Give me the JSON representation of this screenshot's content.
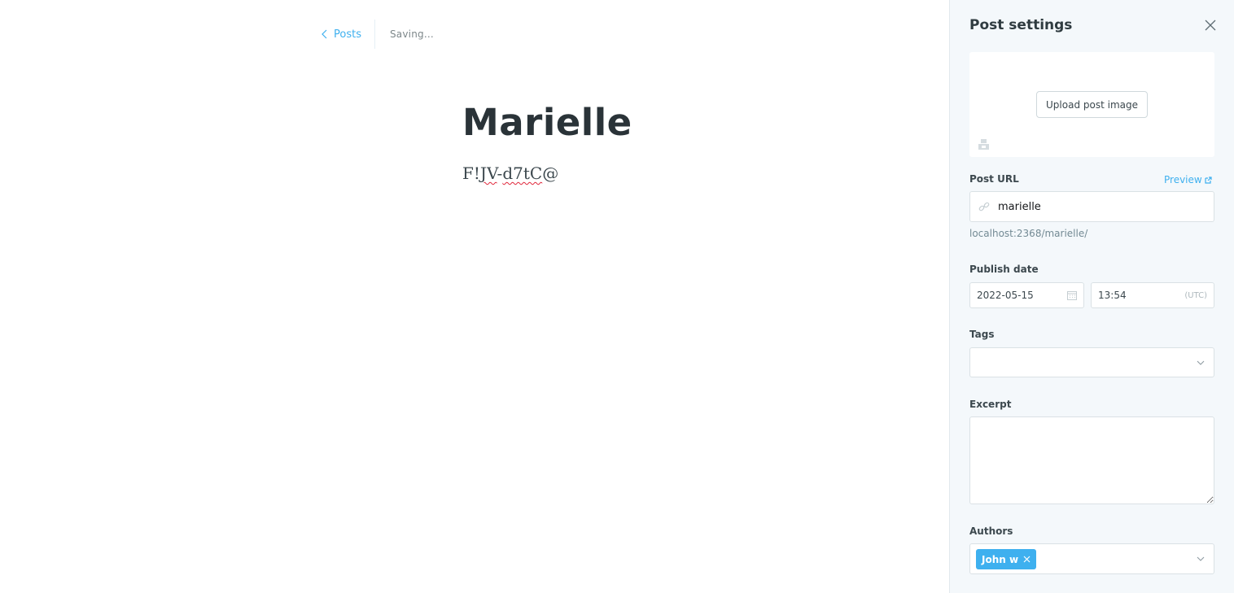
{
  "editor": {
    "back_label": "Posts",
    "status": "Saving...",
    "title": "Marielle",
    "body_parts": [
      "F!",
      "JV",
      "-",
      "d7tC",
      "@"
    ]
  },
  "settings": {
    "title": "Post settings",
    "upload_label": "Upload post image",
    "post_url_label": "Post URL",
    "preview_label": "Preview",
    "slug_value": "marielle",
    "url_hint": "localhost:2368/marielle/",
    "publish_date_label": "Publish date",
    "date_value": "2022-05-15",
    "time_value": "13:54",
    "timezone": "(UTC)",
    "tags_label": "Tags",
    "excerpt_label": "Excerpt",
    "excerpt_value": "",
    "authors_label": "Authors",
    "authors": [
      "John w"
    ]
  },
  "colors": {
    "accent": "#3eb0ef",
    "panel_bg": "#f4f8fb",
    "title_text": "#2a3338",
    "spellcheck": "#e0263a"
  },
  "icons": [
    "chevron-left-icon",
    "close-icon",
    "unsplash-icon",
    "external-link-icon",
    "link-icon",
    "calendar-icon",
    "chevron-down-icon",
    "remove-author-icon"
  ]
}
